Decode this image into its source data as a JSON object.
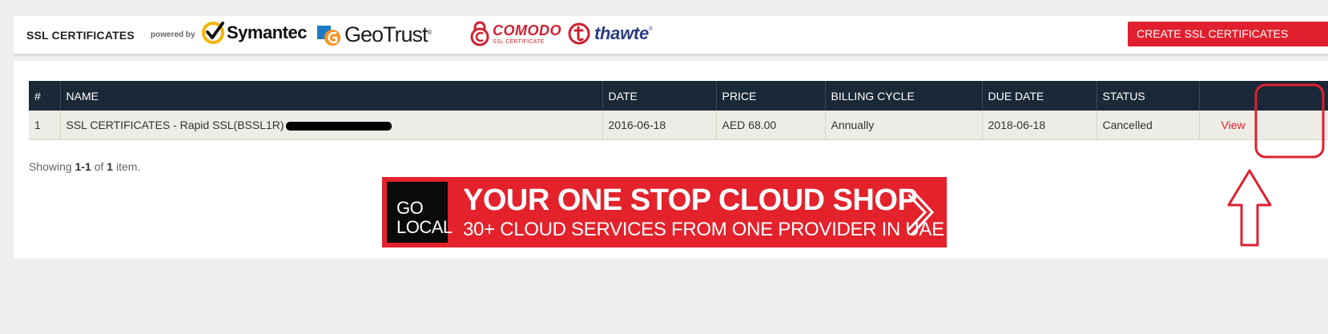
{
  "header": {
    "title": "SSL CERTIFICATES",
    "powered_by": "powered by",
    "brands": {
      "symantec": "Symantec",
      "geotrust": "GeoTrust",
      "geotrust_reg": "®",
      "comodo": "COMODO",
      "comodo_sub": "SSL CERTIFICATE",
      "thawte": "thawte",
      "thawte_reg": "®"
    },
    "create_button": "CREATE SSL CERTIFICATES"
  },
  "table": {
    "columns": [
      "#",
      "NAME",
      "DATE",
      "PRICE",
      "BILLING CYCLE",
      "DUE DATE",
      "STATUS",
      ""
    ],
    "rows": [
      {
        "index": "1",
        "name": "SSL CERTIFICATES - Rapid SSL(BSSL1R)",
        "date": "2016-06-18",
        "price": "AED 68.00",
        "billing_cycle": "Annually",
        "due_date": "2018-06-18",
        "status": "Cancelled",
        "action": "View"
      }
    ]
  },
  "summary": {
    "prefix": "Showing ",
    "range": "1-1",
    "of": " of ",
    "total": "1",
    "suffix": " item."
  },
  "banner": {
    "go": "GO",
    "local": "LOCAL",
    "headline": "YOUR ONE STOP CLOUD SHOP",
    "subline": "30+ CLOUD SERVICES FROM ONE PROVIDER IN UAE"
  },
  "colors": {
    "accent_red": "#e0202e",
    "table_header": "#1b2838",
    "row_bg": "#eeece6",
    "annotation_red": "#e0202e"
  }
}
